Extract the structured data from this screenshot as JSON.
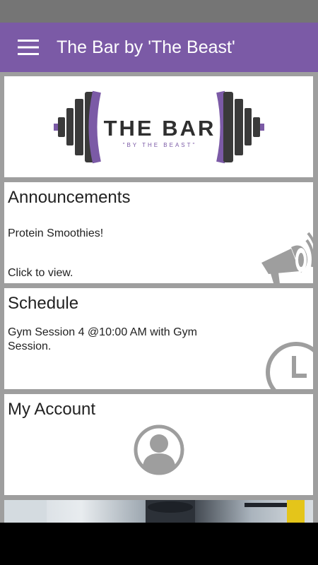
{
  "app_bar": {
    "title": "The Bar by 'The Beast'",
    "menu_icon": "hamburger-menu-icon",
    "color": "#7b5aa6"
  },
  "logo": {
    "name": "THE BAR",
    "tagline": "\"BY THE BEAST\""
  },
  "announcements": {
    "title": "Announcements",
    "item": "Protein Smoothies!",
    "action": "Click to view.",
    "icon": "megaphone-icon"
  },
  "schedule": {
    "title": "Schedule",
    "item": "Gym Session 4 @10:00 AM with Gym Session.",
    "icon": "clock-icon"
  },
  "account": {
    "title": "My Account",
    "icon": "user-avatar-icon"
  },
  "colors": {
    "accent": "#7b5aa6",
    "background": "#9e9e9e",
    "icon_gray": "#9e9e9e"
  }
}
